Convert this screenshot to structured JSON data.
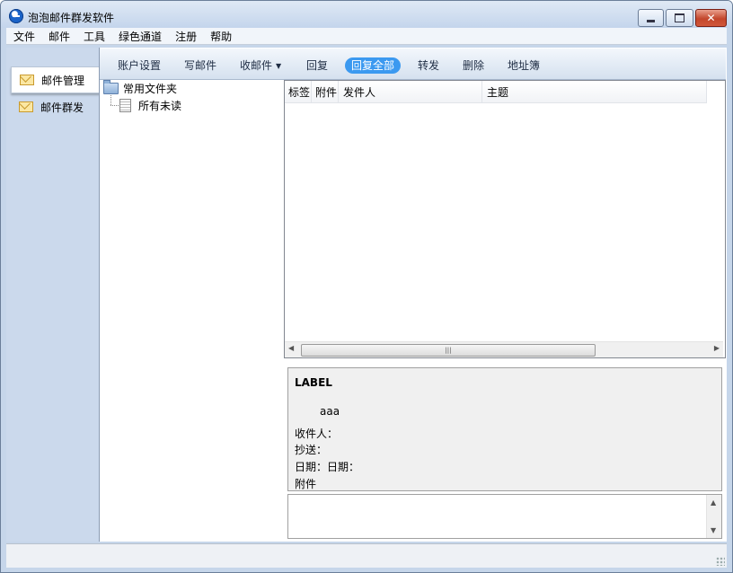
{
  "window": {
    "title": "泡泡邮件群发软件",
    "minimize_label": "minimize",
    "maximize_label": "maximize",
    "close_label": "✕"
  },
  "menubar": {
    "items": [
      "文件",
      "邮件",
      "工具",
      "绿色通道",
      "注册",
      "帮助"
    ]
  },
  "nav": {
    "items": [
      {
        "label": "邮件管理",
        "active": true
      },
      {
        "label": "邮件群发",
        "active": false
      }
    ]
  },
  "toolbar": {
    "account_settings": "账户设置",
    "compose": "写邮件",
    "receive": "收邮件",
    "reply": "回复",
    "reply_all": "回复全部",
    "forward": "转发",
    "delete": "删除",
    "address_book": "地址簿"
  },
  "tree": {
    "root": "常用文件夹",
    "children": [
      "所有未读"
    ]
  },
  "mail_list": {
    "columns": [
      "标签",
      "附件",
      "发件人",
      "主题"
    ],
    "rows": []
  },
  "preview": {
    "label": "LABEL",
    "body": "aaa",
    "to": "收件人：",
    "cc": "抄送：",
    "date": "日期：日期：",
    "attachment": "附件"
  },
  "icons": {
    "app": "app-logo-icon",
    "nav_mail": "envelope-icon",
    "folder": "folder-icon",
    "doc": "document-icon"
  },
  "colors": {
    "accent": "#3b99f0",
    "window_frame": "#c6d6ea",
    "close_button": "#c3462c"
  }
}
